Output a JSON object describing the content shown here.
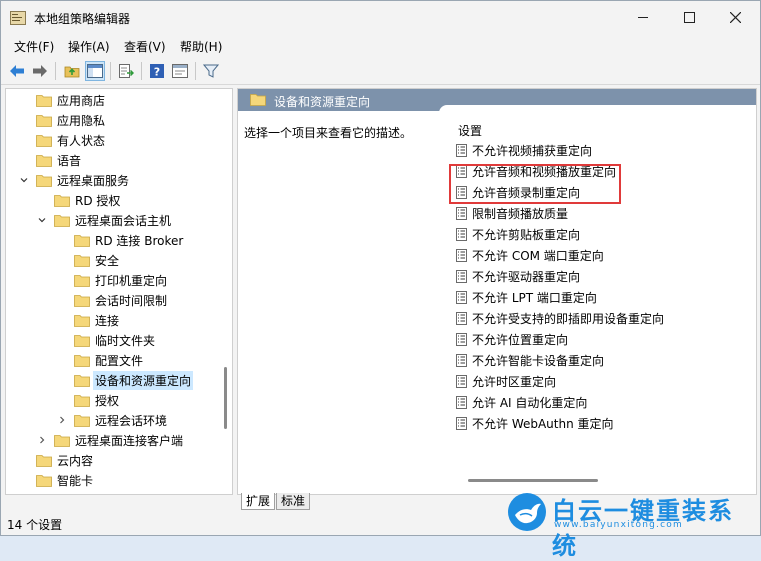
{
  "window": {
    "title": "本地组策略编辑器"
  },
  "menu": [
    "文件(F)",
    "操作(A)",
    "查看(V)",
    "帮助(H)"
  ],
  "toolbar": {
    "icons": [
      "back-arrow-icon",
      "forward-arrow-icon",
      "up-folder-icon",
      "show-hide-tree-icon",
      "export-list-icon",
      "help-icon",
      "properties-icon",
      "filter-icon"
    ]
  },
  "tree": {
    "items": [
      {
        "label": "应用商店",
        "level": 1,
        "expander": "none"
      },
      {
        "label": "应用隐私",
        "level": 1,
        "expander": "none"
      },
      {
        "label": "有人状态",
        "level": 1,
        "expander": "none"
      },
      {
        "label": "语音",
        "level": 1,
        "expander": "none"
      },
      {
        "label": "远程桌面服务",
        "level": 1,
        "expander": "expanded"
      },
      {
        "label": "RD 授权",
        "level": 2,
        "expander": "none"
      },
      {
        "label": "远程桌面会话主机",
        "level": 2,
        "expander": "expanded"
      },
      {
        "label": "RD 连接 Broker",
        "level": 3,
        "expander": "none"
      },
      {
        "label": "安全",
        "level": 3,
        "expander": "none"
      },
      {
        "label": "打印机重定向",
        "level": 3,
        "expander": "none"
      },
      {
        "label": "会话时间限制",
        "level": 3,
        "expander": "none"
      },
      {
        "label": "连接",
        "level": 3,
        "expander": "none"
      },
      {
        "label": "临时文件夹",
        "level": 3,
        "expander": "none"
      },
      {
        "label": "配置文件",
        "level": 3,
        "expander": "none"
      },
      {
        "label": "设备和资源重定向",
        "level": 3,
        "expander": "none",
        "selected": true
      },
      {
        "label": "授权",
        "level": 3,
        "expander": "none"
      },
      {
        "label": "远程会话环境",
        "level": 3,
        "expander": "collapsed"
      },
      {
        "label": "远程桌面连接客户端",
        "level": 2,
        "expander": "collapsed"
      },
      {
        "label": "云内容",
        "level": 1,
        "expander": "none"
      },
      {
        "label": "智能卡",
        "level": 1,
        "expander": "none"
      }
    ]
  },
  "details": {
    "header_title": "设备和资源重定向",
    "description": "选择一个项目来查看它的描述。",
    "settings_heading": "设置",
    "settings": [
      "不允许视频捕获重定向",
      "允许音频和视频播放重定向",
      "允许音频录制重定向",
      "限制音频播放质量",
      "不允许剪贴板重定向",
      "不允许 COM 端口重定向",
      "不允许驱动器重定向",
      "不允许 LPT 端口重定向",
      "不允许受支持的即插即用设备重定向",
      "不允许位置重定向",
      "不允许智能卡设备重定向",
      "允许时区重定向",
      "允许 AI 自动化重定向",
      "不允许 WebAuthn 重定向"
    ],
    "highlighted_rows": [
      1,
      2
    ],
    "highlight_color": "#e03a3a"
  },
  "tabs": [
    "扩展",
    "标准"
  ],
  "status": {
    "text": "14 个设置"
  },
  "watermark": {
    "title": "白云一键重装系统",
    "url": "www.baiyunxitong.com"
  },
  "colors": {
    "header_bar": "#7d92ab",
    "selection": "#cce8ff",
    "watermark": "#1e8de0"
  }
}
